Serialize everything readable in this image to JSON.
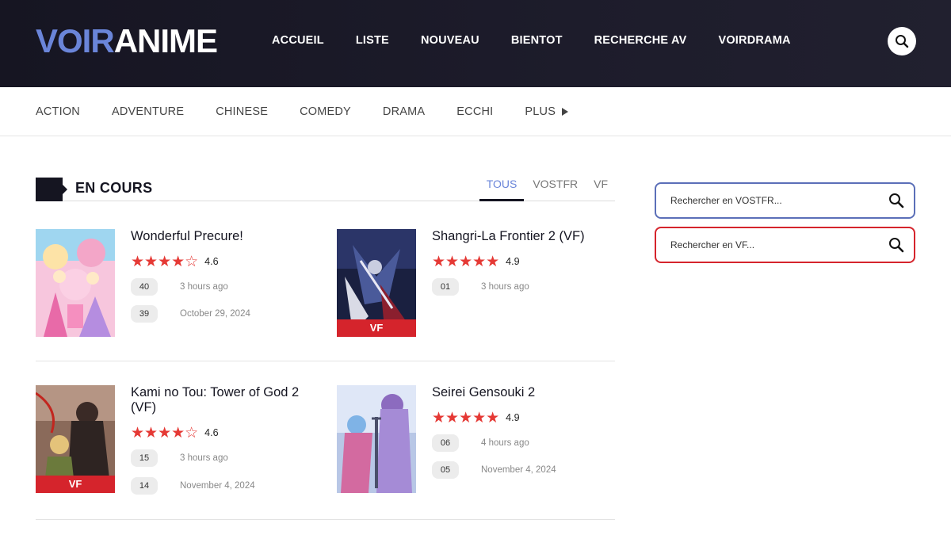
{
  "header": {
    "logo_part1": "VOIR",
    "logo_part2": "ANIME",
    "nav": [
      "ACCUEIL",
      "LISTE",
      "NOUVEAU",
      "BIENTOT",
      "RECHERCHE AV",
      "VOIRDRAMA"
    ],
    "search_icon": "search-icon"
  },
  "genres": {
    "items": [
      "ACTION",
      "ADVENTURE",
      "CHINESE",
      "COMEDY",
      "DRAMA",
      "ECCHI"
    ],
    "more_label": "PLUS"
  },
  "section": {
    "title": "EN COURS",
    "tabs": [
      "TOUS",
      "VOSTFR",
      "VF"
    ],
    "active_tab": "TOUS"
  },
  "cards": [
    {
      "title": "Wonderful Precure!",
      "stars": "★★★★☆",
      "score": "4.6",
      "vf": "",
      "episodes": [
        {
          "num": "40",
          "time": "3 hours ago"
        },
        {
          "num": "39",
          "time": "October 29, 2024"
        }
      ]
    },
    {
      "title": "Shangri-La Frontier 2 (VF)",
      "stars": "★★★★★",
      "score": "4.9",
      "vf": "VF",
      "episodes": [
        {
          "num": "01",
          "time": "3 hours ago"
        }
      ]
    },
    {
      "title": "Kami no Tou: Tower of God 2 (VF)",
      "stars": "★★★★☆",
      "score": "4.6",
      "vf": "VF",
      "episodes": [
        {
          "num": "15",
          "time": "3 hours ago"
        },
        {
          "num": "14",
          "time": "November 4, 2024"
        }
      ]
    },
    {
      "title": "Seirei Gensouki 2",
      "stars": "★★★★★",
      "score": "4.9",
      "vf": "",
      "episodes": [
        {
          "num": "06",
          "time": "4 hours ago"
        },
        {
          "num": "05",
          "time": "November 4, 2024"
        }
      ]
    }
  ],
  "sidebar": {
    "search_vostfr_placeholder": "Rechercher en VOSTFR...",
    "search_vf_placeholder": "Rechercher en VF..."
  },
  "colors": {
    "header_bg": "#1a1927",
    "accent_blue": "#6a85d9",
    "star_red": "#e53935",
    "vf_red": "#d5242c"
  }
}
